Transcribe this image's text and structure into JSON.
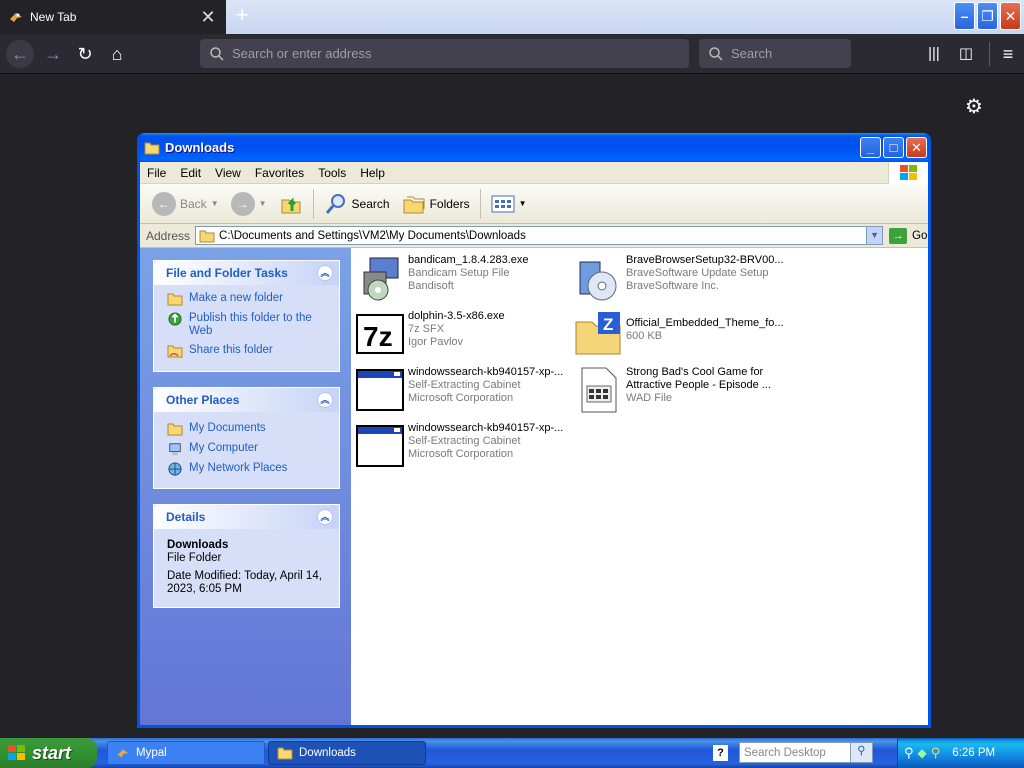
{
  "browser": {
    "tab_title": "New Tab",
    "url_placeholder": "Search or enter address",
    "search_placeholder": "Search"
  },
  "explorer": {
    "title": "Downloads",
    "menu": [
      "File",
      "Edit",
      "View",
      "Favorites",
      "Tools",
      "Help"
    ],
    "toolbar": {
      "back": "Back",
      "search": "Search",
      "folders": "Folders"
    },
    "address_label": "Address",
    "address_value": "C:\\Documents and Settings\\VM2\\My Documents\\Downloads",
    "go_label": "Go",
    "tasks": {
      "title": "File and Folder Tasks",
      "items": [
        "Make a new folder",
        "Publish this folder to the Web",
        "Share this folder"
      ]
    },
    "other_places": {
      "title": "Other Places",
      "items": [
        "My Documents",
        "My Computer",
        "My Network Places"
      ]
    },
    "details": {
      "title": "Details",
      "name": "Downloads",
      "type": "File Folder",
      "modified": "Date Modified: Today, April 14, 2023, 6:05 PM"
    },
    "files": [
      {
        "name": "bandicam_1.8.4.283.exe",
        "line2": "Bandicam Setup File",
        "line3": "Bandisoft",
        "icon": "installer-icon"
      },
      {
        "name": "BraveBrowserSetup32-BRV00...",
        "line2": "BraveSoftware Update Setup",
        "line3": "BraveSoftware Inc.",
        "icon": "setup-cd-icon"
      },
      {
        "name": "dolphin-3.5-x86.exe",
        "line2": "7z SFX",
        "line3": "Igor Pavlov",
        "icon": "7zip-icon"
      },
      {
        "name": "Official_Embedded_Theme_fo...",
        "line2": "600 KB",
        "line3": "",
        "icon": "zip-folder-icon"
      },
      {
        "name": "windowssearch-kb940157-xp-...",
        "line2": "Self-Extracting Cabinet",
        "line3": "Microsoft Corporation",
        "icon": "app-window-icon"
      },
      {
        "name": "Strong Bad's Cool Game for",
        "line2": "Attractive People - Episode ...",
        "line3": "WAD File",
        "icon": "wad-file-icon"
      },
      {
        "name": "windowssearch-kb940157-xp-...",
        "line2": "Self-Extracting Cabinet",
        "line3": "Microsoft Corporation",
        "icon": "app-window-icon"
      }
    ]
  },
  "taskbar": {
    "start": "start",
    "tasks": [
      "Mypal",
      "Downloads"
    ],
    "search_placeholder": "Search Desktop",
    "clock": "6:26 PM"
  }
}
